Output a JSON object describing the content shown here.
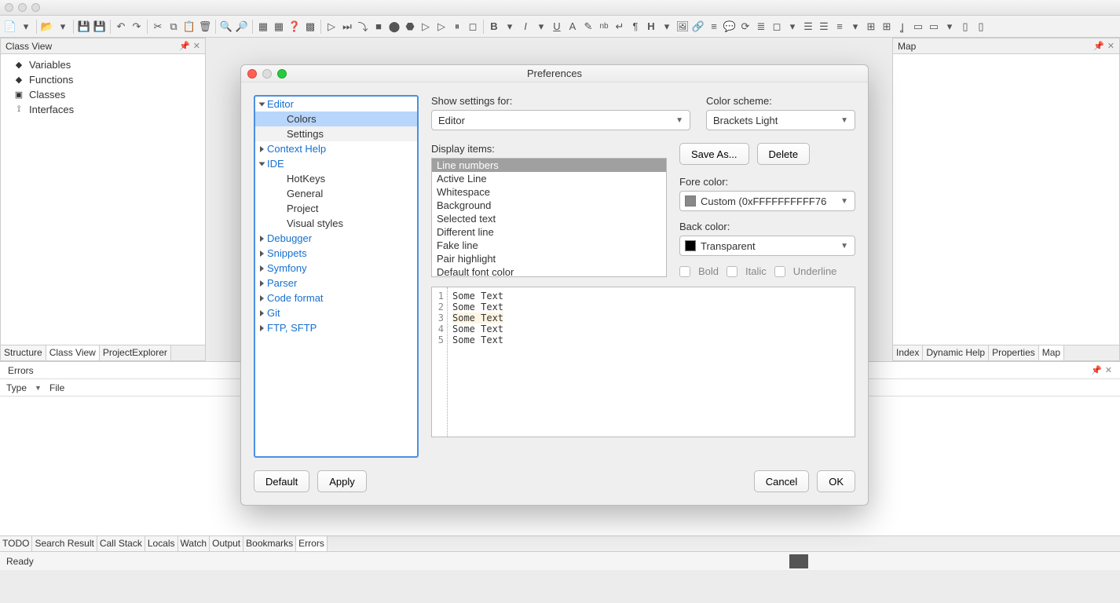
{
  "classview": {
    "title": "Class View",
    "items": [
      {
        "icon": "var",
        "label": "Variables"
      },
      {
        "icon": "func",
        "label": "Functions"
      },
      {
        "icon": "class",
        "label": "Classes"
      },
      {
        "icon": "iface",
        "label": "Interfaces"
      }
    ],
    "tabs": [
      "Structure",
      "Class View",
      "ProjectExplorer"
    ],
    "active_tab": 1
  },
  "map": {
    "title": "Map",
    "tabs": [
      "Index",
      "Dynamic Help",
      "Properties",
      "Map"
    ],
    "active_tab": 3
  },
  "errors": {
    "title": "Errors",
    "cols": [
      "Type",
      "File"
    ]
  },
  "bottom_tabs": {
    "tabs": [
      "TODO",
      "Search Result",
      "Call Stack",
      "Locals",
      "Watch",
      "Output",
      "Bookmarks",
      "Errors"
    ],
    "active_tab": 7
  },
  "status": "Ready",
  "dialog": {
    "title": "Preferences",
    "tree": [
      {
        "label": "Editor",
        "type": "group",
        "open": true
      },
      {
        "label": "Colors",
        "type": "child",
        "selected": true
      },
      {
        "label": "Settings",
        "type": "child"
      },
      {
        "label": "Context Help",
        "type": "link"
      },
      {
        "label": "IDE",
        "type": "group",
        "open": true
      },
      {
        "label": "HotKeys",
        "type": "child"
      },
      {
        "label": "General",
        "type": "child"
      },
      {
        "label": "Project",
        "type": "child"
      },
      {
        "label": "Visual styles",
        "type": "child"
      },
      {
        "label": "Debugger",
        "type": "link"
      },
      {
        "label": "Snippets",
        "type": "link"
      },
      {
        "label": "Symfony",
        "type": "link"
      },
      {
        "label": "Parser",
        "type": "link"
      },
      {
        "label": "Code format",
        "type": "link"
      },
      {
        "label": "Git",
        "type": "link"
      },
      {
        "label": "FTP, SFTP",
        "type": "link"
      }
    ],
    "labels": {
      "show_settings": "Show settings for:",
      "color_scheme": "Color scheme:",
      "display_items": "Display items:",
      "fore_color": "Fore color:",
      "back_color": "Back color:",
      "bold": "Bold",
      "italic": "Italic",
      "underline": "Underline"
    },
    "show_settings_value": "Editor",
    "color_scheme_value": "Brackets Light",
    "display_items": [
      "Line numbers",
      "Active Line",
      "Whitespace",
      "Background",
      "Selected text",
      "Different line",
      "Fake line",
      "Pair highlight",
      "Default font color"
    ],
    "display_selected": 0,
    "fore_color_value": "Custom (0xFFFFFFFFFF76",
    "fore_swatch": "#888888",
    "back_color_value": "Transparent",
    "back_swatch": "#000000",
    "buttons": {
      "save_as": "Save As...",
      "delete": "Delete",
      "default": "Default",
      "apply": "Apply",
      "cancel": "Cancel",
      "ok": "OK"
    },
    "preview_lines": [
      "Some Text",
      "Some Text",
      "Some Text",
      "Some Text",
      "Some Text"
    ],
    "preview_highlight": 2
  }
}
